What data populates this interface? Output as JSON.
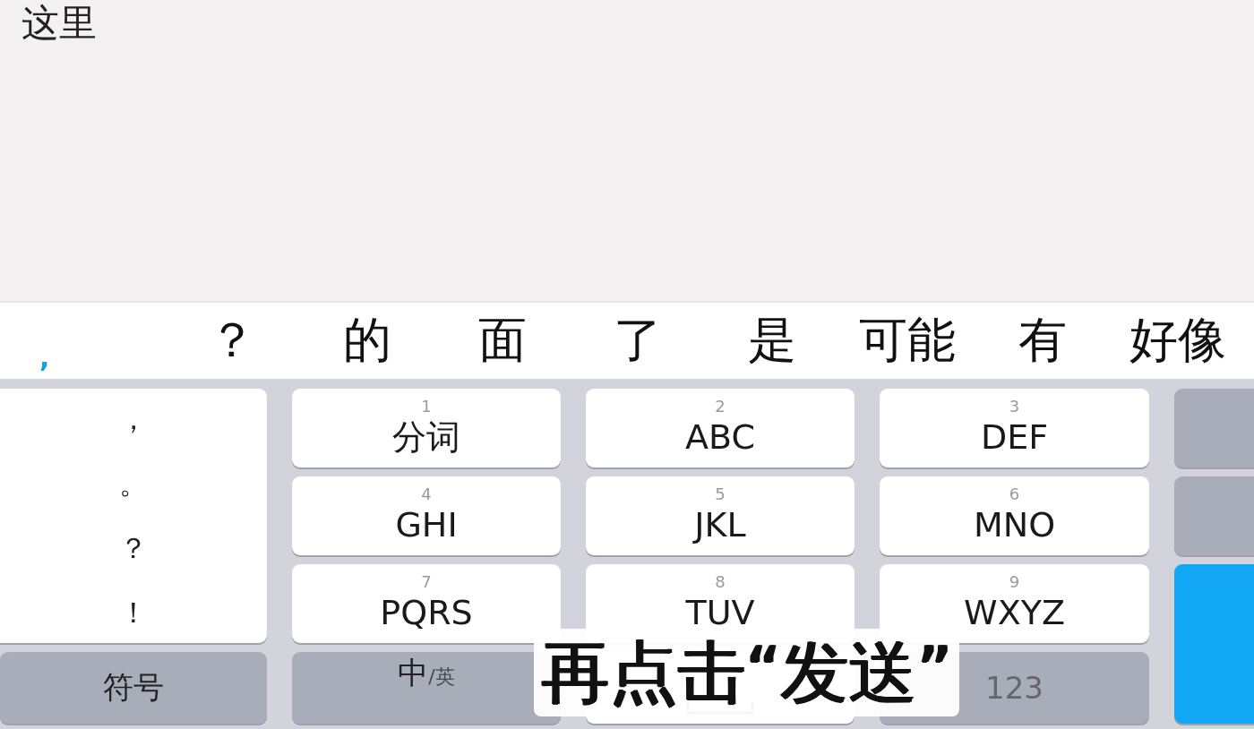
{
  "input": {
    "text": "这里"
  },
  "candidate_bar": {
    "composition": ",",
    "candidates": [
      "？",
      "的",
      "面",
      "了",
      "是",
      "可能",
      "有",
      "好像"
    ]
  },
  "punctuation_key": [
    "，",
    "。",
    "？",
    "！"
  ],
  "keys": [
    {
      "digit": "1",
      "letters": "分词"
    },
    {
      "digit": "2",
      "letters": "ABC"
    },
    {
      "digit": "3",
      "letters": "DEF"
    },
    {
      "digit": "4",
      "letters": "GHI"
    },
    {
      "digit": "5",
      "letters": "JKL"
    },
    {
      "digit": "6",
      "letters": "MNO"
    },
    {
      "digit": "7",
      "letters": "PQRS"
    },
    {
      "digit": "8",
      "letters": "TUV"
    },
    {
      "digit": "9",
      "letters": "WXYZ"
    }
  ],
  "side_keys": [
    {
      "kind": "function"
    },
    {
      "kind": "function"
    },
    {
      "kind": "send"
    }
  ],
  "bottom_row": {
    "symbol_key": "符号",
    "lang_key": {
      "main": "中",
      "alt": "/英"
    },
    "num_key": "123"
  },
  "caption": "再点击“发送”"
}
